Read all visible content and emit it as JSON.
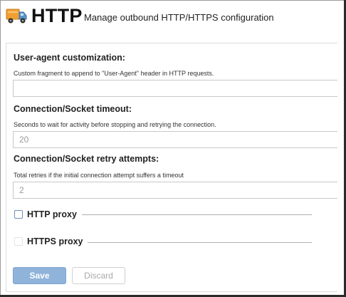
{
  "header": {
    "title": "HTTP",
    "subtitle": "Manage outbound HTTP/HTTPS configuration",
    "icon": "delivery-truck-icon"
  },
  "user_agent": {
    "label": "User-agent customization:",
    "help": "Custom fragment to append to \"User-Agent\" header in HTTP requests.",
    "value": "",
    "placeholder": ""
  },
  "timeout": {
    "label": "Connection/Socket timeout:",
    "help": "Seconds to wait for activity before stopping and retrying the connection.",
    "value": "20"
  },
  "retry": {
    "label": "Connection/Socket retry attempts:",
    "help": "Total retries if the initial connection attempt suffers a timeout",
    "value": "2"
  },
  "http_proxy": {
    "label": "HTTP proxy",
    "checked": false
  },
  "https_proxy": {
    "label": "HTTPS proxy",
    "checked": false,
    "enabled": false
  },
  "actions": {
    "save_label": "Save",
    "discard_label": "Discard"
  },
  "colors": {
    "save_bg": "#8fb3d9",
    "truck_body": "#f2a033",
    "truck_cab": "#5b93c9"
  }
}
